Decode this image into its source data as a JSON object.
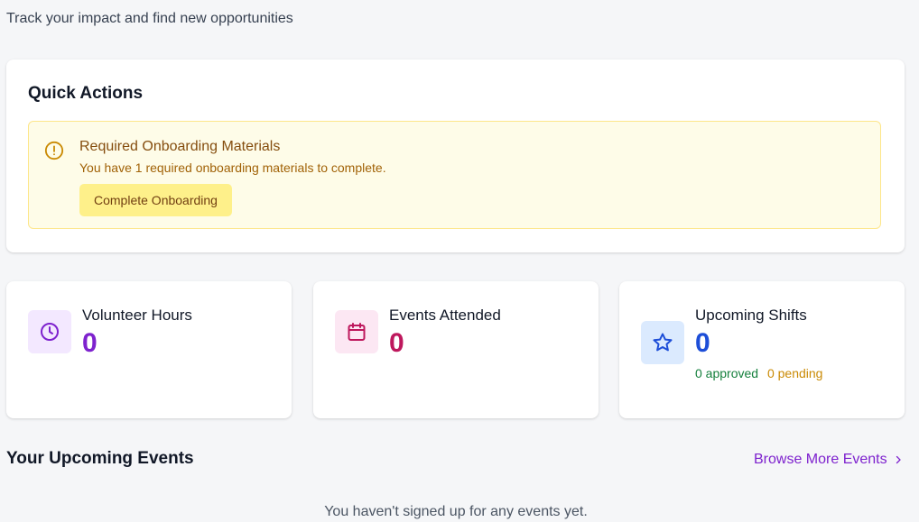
{
  "header": {
    "subtitle": "Track your impact and find new opportunities"
  },
  "quick_actions": {
    "title": "Quick Actions",
    "alert": {
      "icon": "alert-circle-icon",
      "title": "Required Onboarding Materials",
      "text": "You have 1 required onboarding materials to complete.",
      "button": "Complete Onboarding"
    }
  },
  "stats": [
    {
      "label": "Volunteer Hours",
      "value": "0",
      "icon": "clock-icon",
      "color": "#7e22ce",
      "icon_bg": "#f3e8ff"
    },
    {
      "label": "Events Attended",
      "value": "0",
      "icon": "calendar-icon",
      "color": "#be185d",
      "icon_bg": "#fce7f3"
    },
    {
      "label": "Upcoming Shifts",
      "value": "0",
      "icon": "star-icon",
      "color": "#1d4ed8",
      "icon_bg": "#dbeafe",
      "approved": "0 approved",
      "pending": "0 pending"
    }
  ],
  "colors": {
    "approved": "#15803d",
    "pending": "#ca8a04"
  },
  "upcoming": {
    "title": "Your Upcoming Events",
    "browse_link": "Browse More Events",
    "empty": "You haven't signed up for any events yet."
  }
}
